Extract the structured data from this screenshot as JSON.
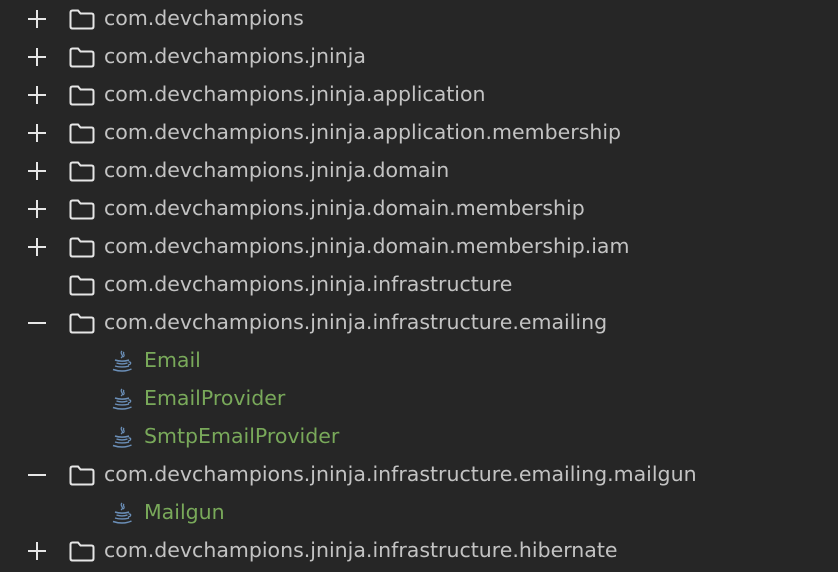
{
  "colors": {
    "background": "#262626",
    "package_text": "#c3c3c3",
    "file_text": "#79a95a",
    "icon": "#e6e6e6",
    "java_icon": "#6b8fb8"
  },
  "tree": [
    {
      "label": "com.devchampions",
      "toggle": "plus",
      "kind": "package"
    },
    {
      "label": "com.devchampions.jninja",
      "toggle": "plus",
      "kind": "package"
    },
    {
      "label": "com.devchampions.jninja.application",
      "toggle": "plus",
      "kind": "package"
    },
    {
      "label": "com.devchampions.jninja.application.membership",
      "toggle": "plus",
      "kind": "package"
    },
    {
      "label": "com.devchampions.jninja.domain",
      "toggle": "plus",
      "kind": "package"
    },
    {
      "label": "com.devchampions.jninja.domain.membership",
      "toggle": "plus",
      "kind": "package"
    },
    {
      "label": "com.devchampions.jninja.domain.membership.iam",
      "toggle": "plus",
      "kind": "package"
    },
    {
      "label": "com.devchampions.jninja.infrastructure",
      "toggle": "none",
      "kind": "package"
    },
    {
      "label": "com.devchampions.jninja.infrastructure.emailing",
      "toggle": "minus",
      "kind": "package"
    },
    {
      "label": "Email",
      "kind": "java-file",
      "icon": "java-icon"
    },
    {
      "label": "EmailProvider",
      "kind": "java-file",
      "icon": "java-icon"
    },
    {
      "label": "SmtpEmailProvider",
      "kind": "java-file",
      "icon": "java-icon"
    },
    {
      "label": "com.devchampions.jninja.infrastructure.emailing.mailgun",
      "toggle": "minus",
      "kind": "package"
    },
    {
      "label": "Mailgun",
      "kind": "java-file",
      "icon": "java-icon"
    },
    {
      "label": "com.devchampions.jninja.infrastructure.hibernate",
      "toggle": "plus",
      "kind": "package"
    }
  ]
}
